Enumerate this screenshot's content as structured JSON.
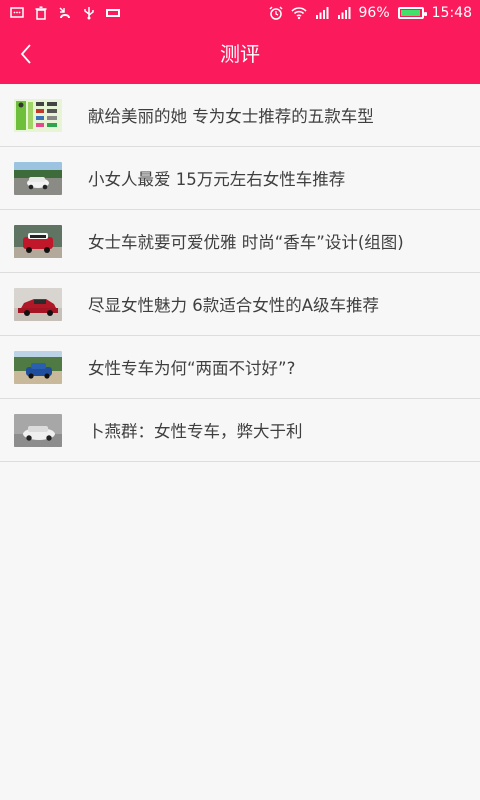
{
  "status_bar": {
    "battery_percent": "96%",
    "time": "15:48",
    "icons": [
      "message-icon",
      "trash-icon",
      "missed-call-icon",
      "usb-icon",
      "carrier-icon",
      "alarm-icon",
      "wifi-icon",
      "signal-icon",
      "signal-icon-2",
      "battery-icon"
    ]
  },
  "header": {
    "title": "测评",
    "back_icon": "chevron-left-icon",
    "background_color": "#fb1a5c"
  },
  "articles": [
    {
      "title": "献给美丽的她 专为女士推荐的五款车型",
      "thumb": "green-collage"
    },
    {
      "title": "小女人最爱 15万元左右女性车推荐",
      "thumb": "white-car-road"
    },
    {
      "title": "女士车就要可爱优雅 时尚“香车”设计(组图)",
      "thumb": "red-mini"
    },
    {
      "title": "尽显女性魅力 6款适合女性的A级车推荐",
      "thumb": "red-sedan"
    },
    {
      "title": "女性专车为何“两面不讨好”?",
      "thumb": "blue-car-trees"
    },
    {
      "title": "卜燕群：女性专车，弊大于利",
      "thumb": "white-car-gray"
    }
  ]
}
